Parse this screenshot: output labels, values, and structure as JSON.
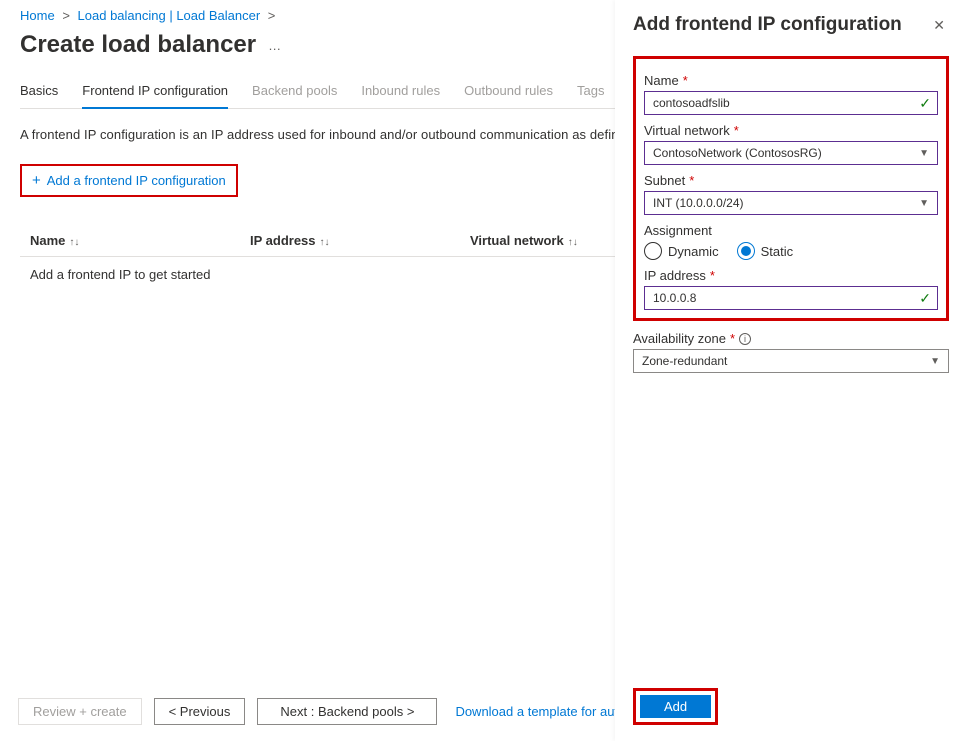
{
  "breadcrumb": {
    "home": "Home",
    "page1": "Load balancing | Load Balancer"
  },
  "page_title": "Create load balancer",
  "tabs": {
    "basics": "Basics",
    "frontend": "Frontend IP configuration",
    "backend": "Backend pools",
    "inbound": "Inbound rules",
    "outbound": "Outbound rules",
    "tags": "Tags"
  },
  "description": "A frontend IP configuration is an IP address used for inbound and/or outbound communication as defined withi",
  "add_config_label": "Add a frontend IP configuration",
  "table": {
    "col_name": "Name",
    "col_ip": "IP address",
    "col_vnet": "Virtual network",
    "empty_row": "Add a frontend IP to get started"
  },
  "footer": {
    "review": "Review + create",
    "prev": "< Previous",
    "next": "Next : Backend pools >",
    "download": "Download a template for automati"
  },
  "panel": {
    "title": "Add frontend IP configuration",
    "labels": {
      "name": "Name",
      "vnet": "Virtual network",
      "subnet": "Subnet",
      "assignment": "Assignment",
      "dynamic": "Dynamic",
      "static": "Static",
      "ip": "IP address",
      "az": "Availability zone"
    },
    "values": {
      "name": "contosoadfslib",
      "vnet": "ContosoNetwork (ContososRG)",
      "subnet": "INT (10.0.0.0/24)",
      "ip": "10.0.0.8",
      "az": "Zone-redundant"
    },
    "add_btn": "Add"
  }
}
